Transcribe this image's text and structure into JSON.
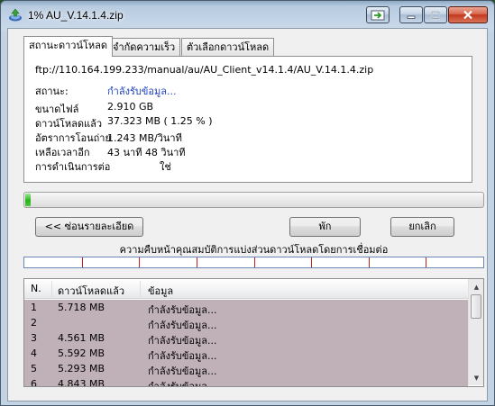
{
  "window": {
    "title": "1% AU_V.14.1.4.zip"
  },
  "tabs": [
    {
      "label": "สถานะดาวน์โหลด"
    },
    {
      "label": "จำกัดความเร็ว"
    },
    {
      "label": "ตัวเลือกดาวน์โหลด"
    }
  ],
  "download": {
    "url": "ftp://110.164.199.233/manual/au/AU_Client_v14.1.4/AU_V.14.1.4.zip",
    "status_label": "สถานะ:",
    "status_value": "กำลังรับข้อมูล...",
    "rows": [
      {
        "label": "ขนาดไฟล์",
        "value": "2.910  GB"
      },
      {
        "label": "ดาวน์โหลดแล้ว",
        "value": "37.323  MB  ( 1.25 % )"
      },
      {
        "label": "อัตราการโอนถ่าย",
        "value": "1.243  MB/วินาที"
      },
      {
        "label": "เหลือเวลาอีก",
        "value": "43 นาที 48 วินาที"
      },
      {
        "label": "การดำเนินการต่อ",
        "value": "ใช่"
      }
    ],
    "progress_fraction": 0.0125
  },
  "buttons": {
    "hide_details": "<< ซ่อนรายละเอียด",
    "pause": "พัก",
    "cancel": "ยกเลิก"
  },
  "segments": {
    "caption": "ความคืบหน้าคุณสมบัติการแบ่งส่วนดาวน์โหลดโดยการเชื่อมต่อ",
    "count": 8
  },
  "connections": {
    "columns": [
      "N.",
      "ดาวน์โหลดแล้ว",
      "ข้อมูล"
    ],
    "rows": [
      {
        "n": "1",
        "downloaded": "5.718  MB",
        "info": "กำลังรับข้อมูล..."
      },
      {
        "n": "2",
        "downloaded": "",
        "info": "กำลังรับข้อมูล..."
      },
      {
        "n": "3",
        "downloaded": "4.561  MB",
        "info": "กำลังรับข้อมูล..."
      },
      {
        "n": "4",
        "downloaded": "5.592  MB",
        "info": "กำลังรับข้อมูล..."
      },
      {
        "n": "5",
        "downloaded": "5.293  MB",
        "info": "กำลังรับข้อมูล..."
      },
      {
        "n": "6",
        "downloaded": "4.843  MB",
        "info": "กำลังรับข้อมูล..."
      }
    ]
  },
  "colors": {
    "progress_green": "#29b21b",
    "status_blue": "#1c3fbb",
    "segment_tick": "#cc1e1e",
    "list_row_bg": "#c0b1b9"
  }
}
